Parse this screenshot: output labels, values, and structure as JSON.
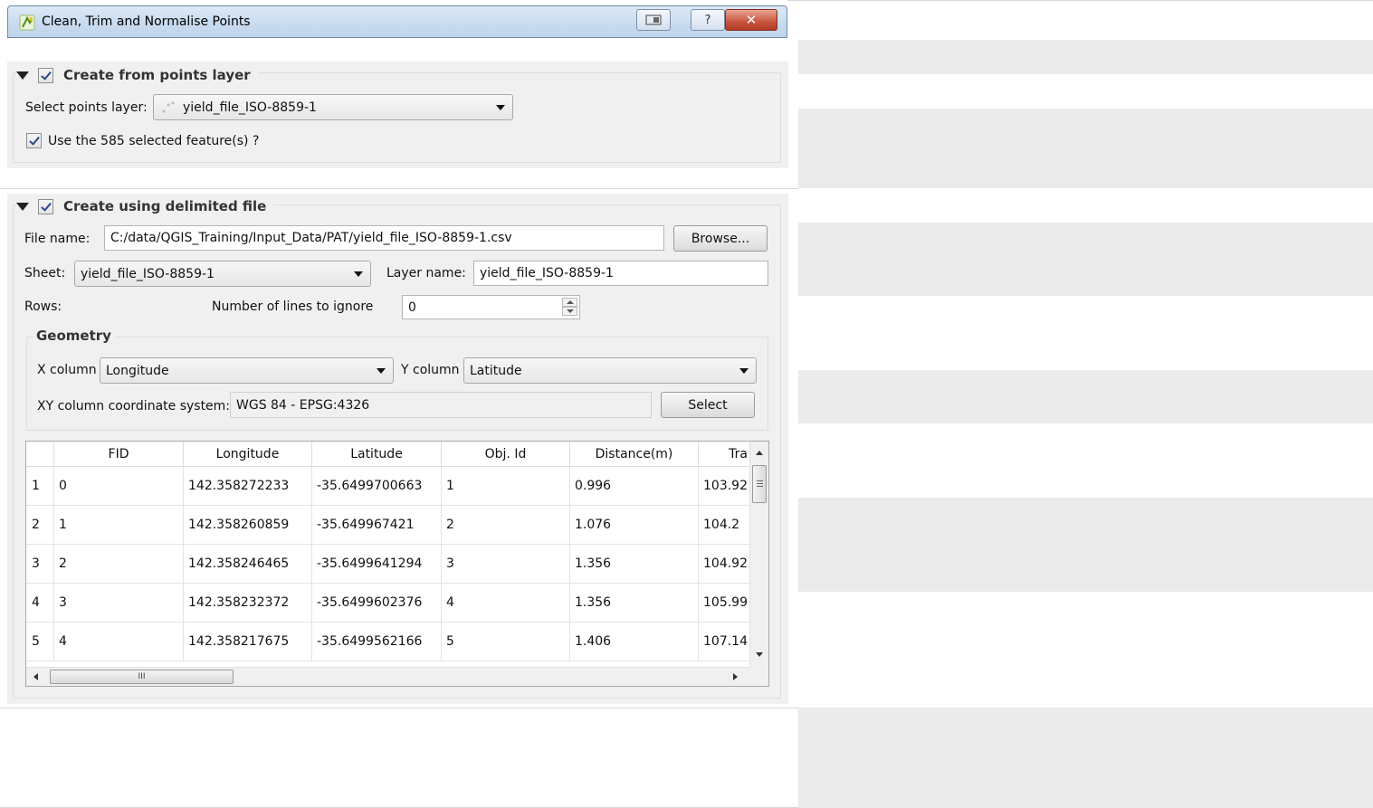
{
  "window": {
    "title": "Clean, Trim and Normalise Points",
    "help_label": "?",
    "close_label": "✕"
  },
  "points_section": {
    "header": "Create from points layer",
    "select_label": "Select points layer:",
    "layer_value": "yield_file_ISO-8859-1",
    "use_selected_label": "Use the 585 selected feature(s) ?"
  },
  "file_section": {
    "header": "Create using delimited file",
    "file_name_label": "File name:",
    "file_name_value": "C:/data/QGIS_Training/Input_Data/PAT/yield_file_ISO-8859-1.csv",
    "browse_label": "Browse...",
    "sheet_label": "Sheet:",
    "sheet_value": "yield_file_ISO-8859-1",
    "layer_name_label": "Layer name:",
    "layer_name_value": "yield_file_ISO-8859-1",
    "rows_label": "Rows:",
    "ignore_label": "Number of lines to ignore",
    "ignore_value": "0",
    "geometry": {
      "title": "Geometry",
      "x_label": "X column",
      "x_value": "Longitude",
      "y_label": "Y column",
      "y_value": "Latitude",
      "crs_label": "XY column coordinate system:",
      "crs_value": "WGS 84  -  EPSG:4326",
      "select_label": "Select"
    }
  },
  "table": {
    "columns": [
      "FID",
      "Longitude",
      "Latitude",
      "Obj. Id",
      "Distance(m)",
      "Tra"
    ],
    "row_headers": [
      "1",
      "2",
      "3",
      "4",
      "5"
    ],
    "rows": [
      [
        "0",
        "142.358272233",
        "-35.6499700663",
        "1",
        "0.996",
        "103.92"
      ],
      [
        "1",
        "142.358260859",
        "-35.649967421",
        "2",
        "1.076",
        "104.2"
      ],
      [
        "2",
        "142.358246465",
        "-35.6499641294",
        "3",
        "1.356",
        "104.92"
      ],
      [
        "3",
        "142.358232372",
        "-35.6499602376",
        "4",
        "1.356",
        "105.99"
      ],
      [
        "4",
        "142.358217675",
        "-35.6499562166",
        "5",
        "1.406",
        "107.14"
      ]
    ],
    "hscroll_grip": "III"
  },
  "colors": {
    "titlebar": "#c9dcf0",
    "panel": "#f0f0f0",
    "stripe": "#ebebeb"
  }
}
